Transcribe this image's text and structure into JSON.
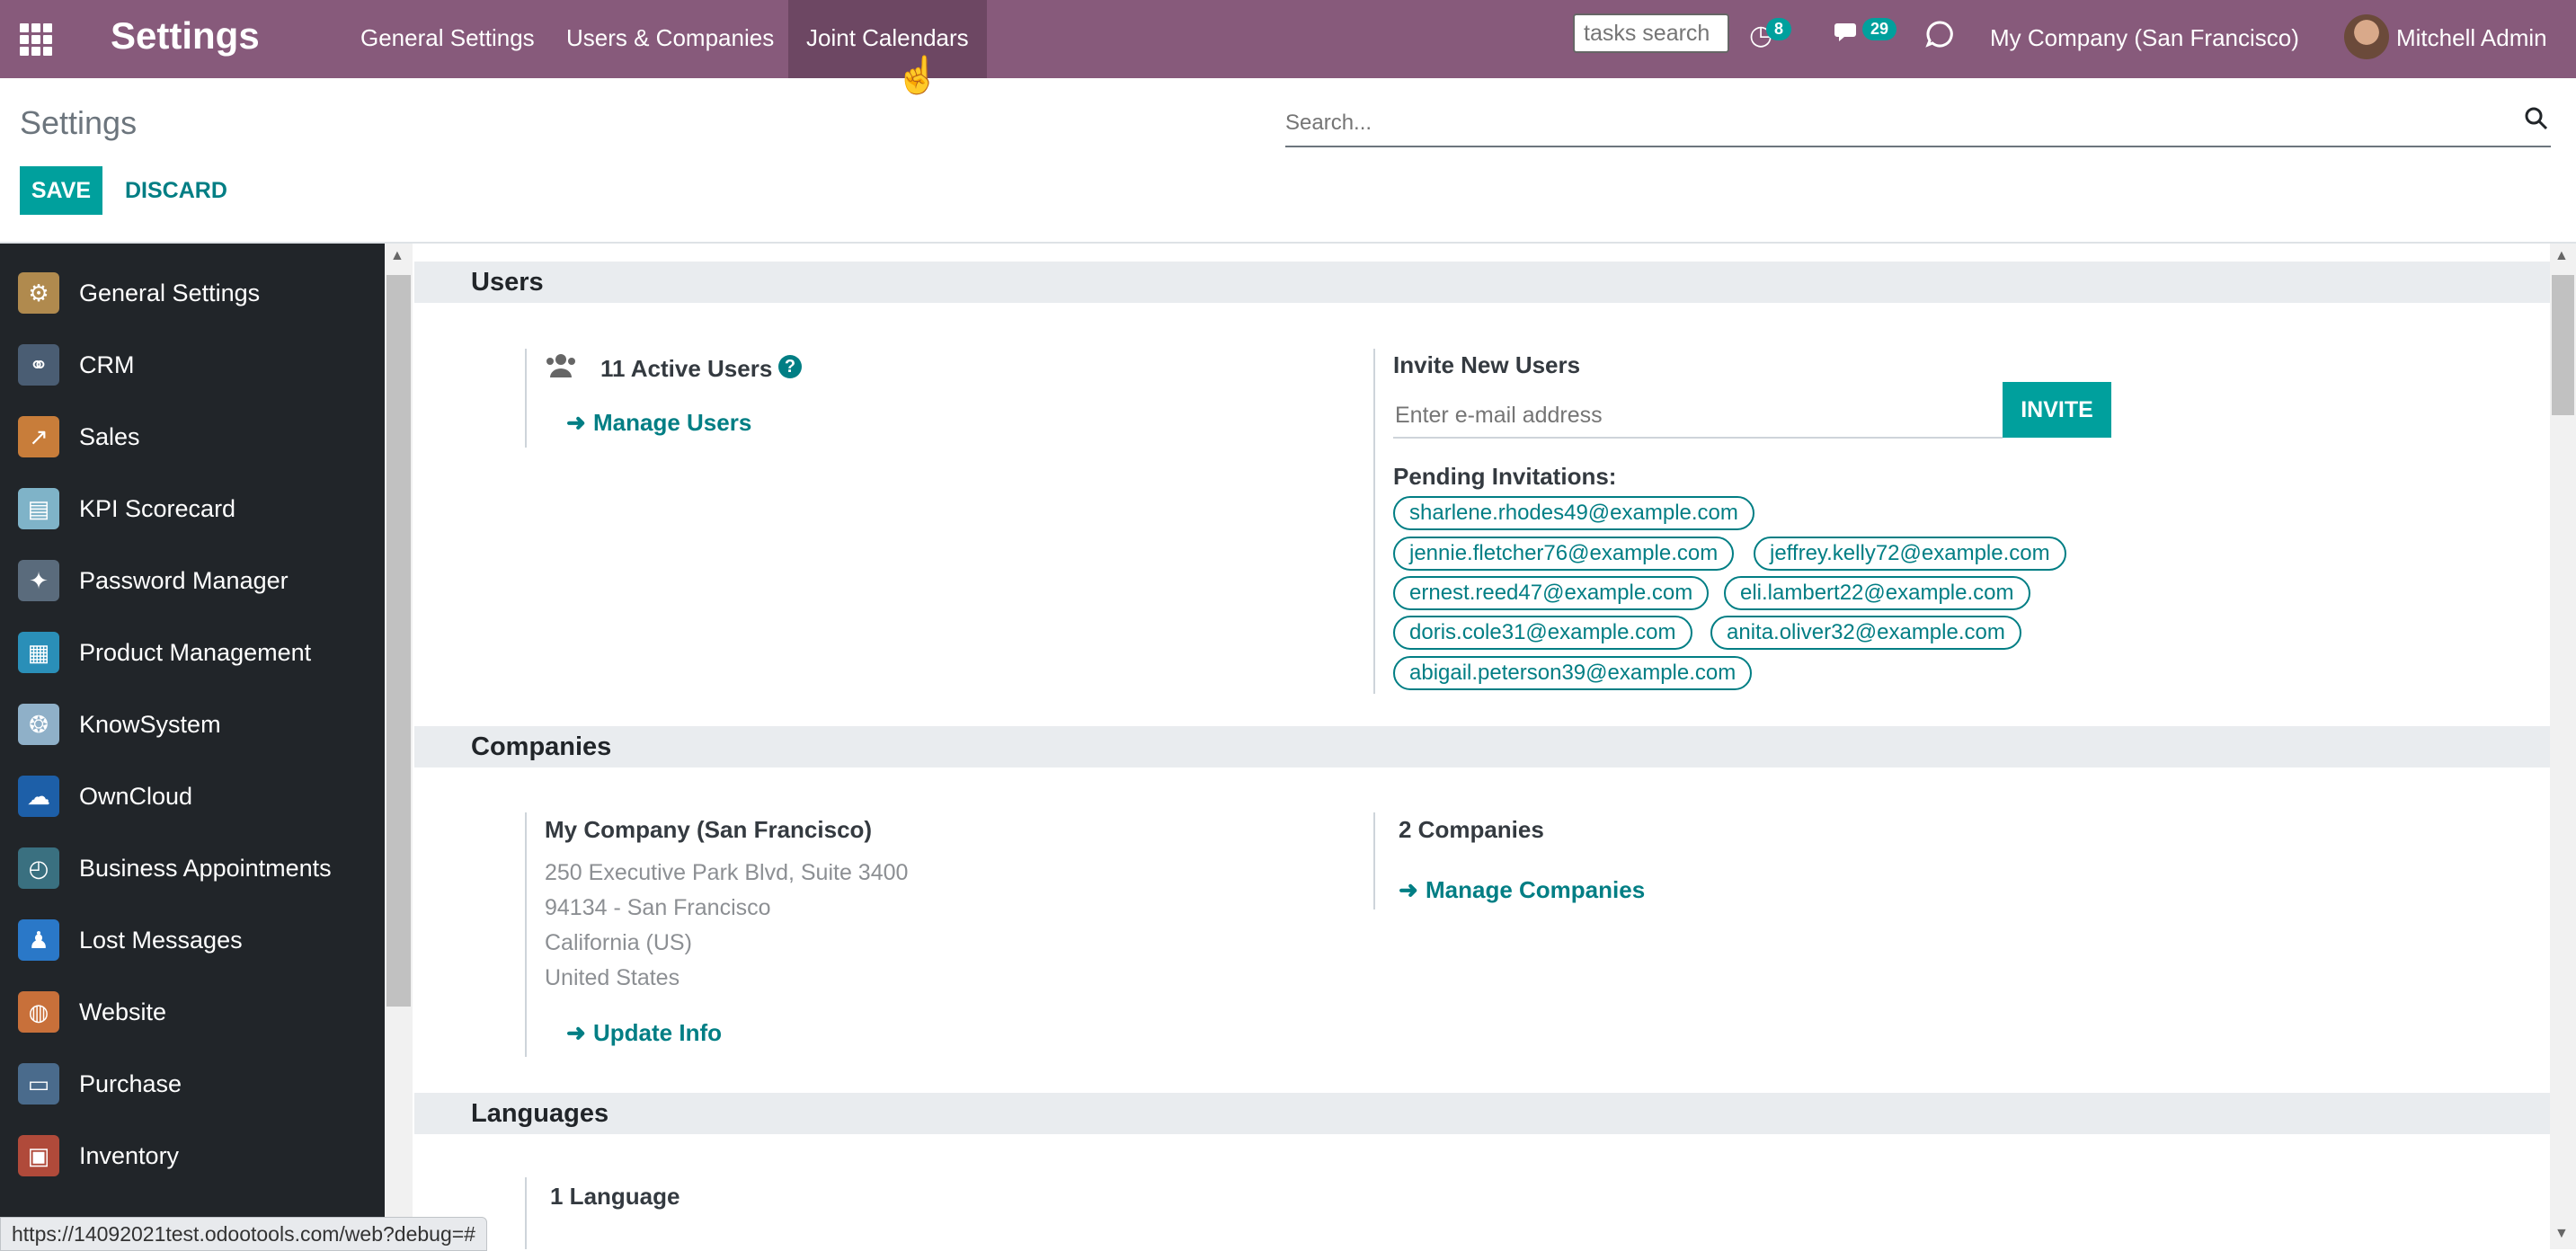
{
  "navbar": {
    "brand": "Settings",
    "menu": [
      "General Settings",
      "Users & Companies",
      "Joint Calendars"
    ],
    "search_placeholder": "tasks search",
    "activity_badge": "8",
    "messages_badge": "29",
    "company": "My Company (San Francisco)",
    "user": "Mitchell Admin"
  },
  "control_panel": {
    "title": "Settings",
    "search_placeholder": "Search...",
    "save_label": "SAVE",
    "discard_label": "DISCARD"
  },
  "sidebar": {
    "items": [
      {
        "label": "General Settings",
        "icon": "gear-icon",
        "color": "#b08a4e"
      },
      {
        "label": "CRM",
        "icon": "handshake-icon",
        "color": "#4a5d73"
      },
      {
        "label": "Sales",
        "icon": "chart-icon",
        "color": "#c87d3a"
      },
      {
        "label": "KPI Scorecard",
        "icon": "scorecard-icon",
        "color": "#7fb3c8"
      },
      {
        "label": "Password Manager",
        "icon": "password-icon",
        "color": "#5a6b7c"
      },
      {
        "label": "Product Management",
        "icon": "product-icon",
        "color": "#2a8fb8"
      },
      {
        "label": "KnowSystem",
        "icon": "brain-icon",
        "color": "#8fb0c8"
      },
      {
        "label": "OwnCloud",
        "icon": "cloud-icon",
        "color": "#1d5fa8"
      },
      {
        "label": "Business Appointments",
        "icon": "clock-icon",
        "color": "#3a7080"
      },
      {
        "label": "Lost Messages",
        "icon": "lost-user-icon",
        "color": "#2a78c8"
      },
      {
        "label": "Website",
        "icon": "globe-icon",
        "color": "#c8703a"
      },
      {
        "label": "Purchase",
        "icon": "card-icon",
        "color": "#4a6b8c"
      },
      {
        "label": "Inventory",
        "icon": "box-icon",
        "color": "#b04a3a"
      }
    ]
  },
  "users": {
    "heading": "Users",
    "active_users": "11 Active Users",
    "manage_users": "Manage Users",
    "invite_title": "Invite New Users",
    "invite_placeholder": "Enter e-mail address",
    "invite_label": "INVITE",
    "pending_title": "Pending Invitations:",
    "pending": [
      "sharlene.rhodes49@example.com",
      "jennie.fletcher76@example.com",
      "jeffrey.kelly72@example.com",
      "ernest.reed47@example.com",
      "eli.lambert22@example.com",
      "doris.cole31@example.com",
      "anita.oliver32@example.com",
      "abigail.peterson39@example.com"
    ]
  },
  "companies": {
    "heading": "Companies",
    "company_name": "My Company (San Francisco)",
    "address": [
      "250 Executive Park Blvd, Suite 3400",
      "94134 - San Francisco",
      "California (US)",
      "United States"
    ],
    "update_info": "Update Info",
    "count": "2 Companies",
    "manage_companies": "Manage Companies"
  },
  "languages": {
    "heading": "Languages",
    "count": "1 Language"
  },
  "status_url": "https://14092021test.odootools.com/web?debug=#"
}
